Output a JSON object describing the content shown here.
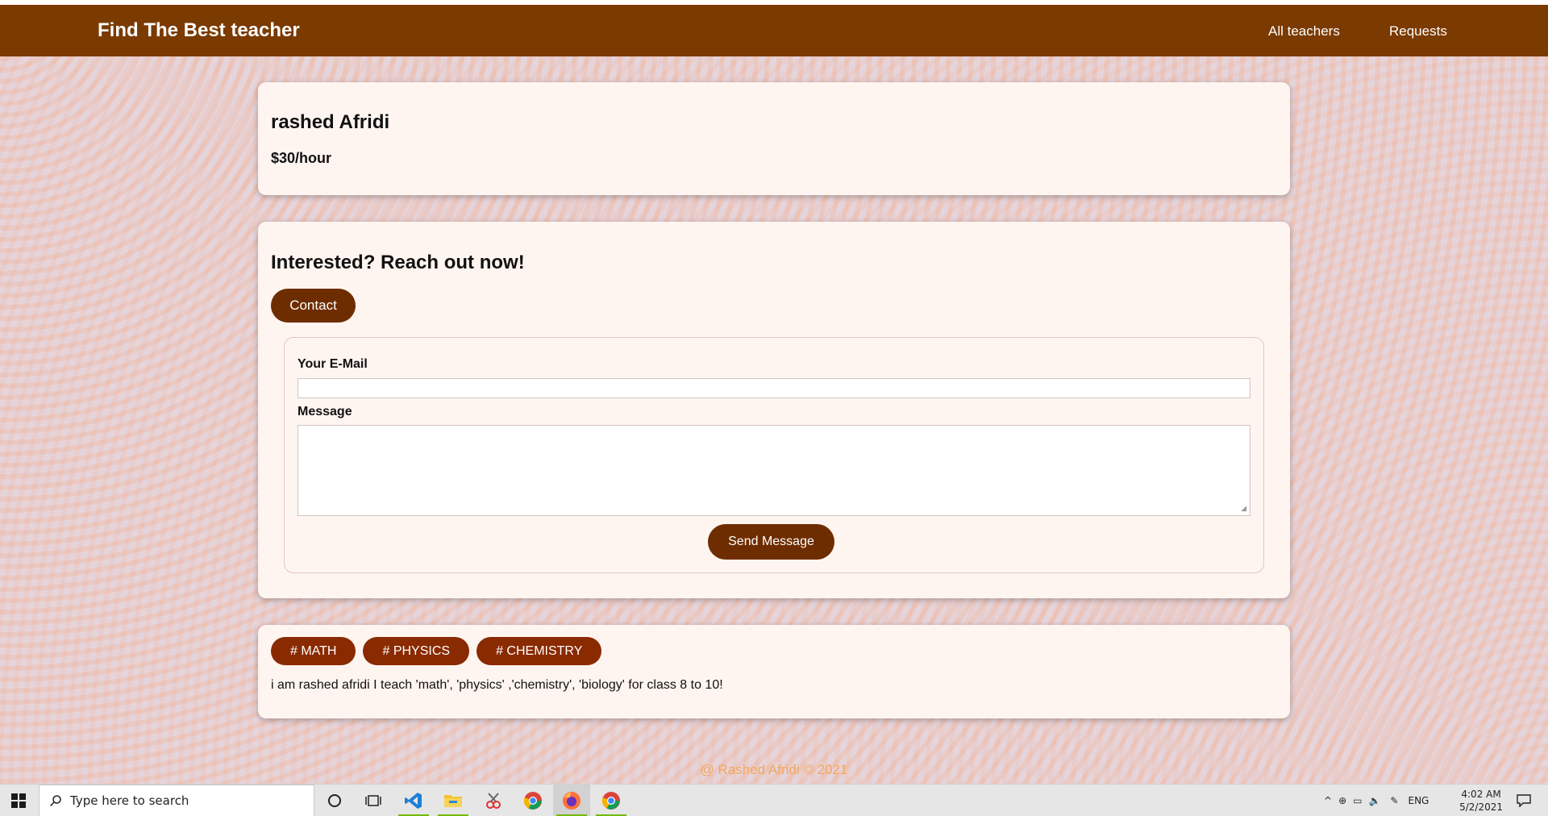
{
  "header": {
    "brand": "Find The Best teacher",
    "nav": [
      "All teachers",
      "Requests"
    ]
  },
  "teacher": {
    "name": "rashed Afridi",
    "rate": "$30/hour"
  },
  "contact_section": {
    "title": "Interested? Reach out now!",
    "contact_button": "Contact",
    "email_label": "Your E-Mail",
    "email_value": "",
    "message_label": "Message",
    "message_value": "",
    "send_button": "Send Message"
  },
  "details": {
    "tags": [
      "# MATH",
      "# PHYSICS",
      "# CHEMISTRY"
    ],
    "description": "i am rashed afridi I teach 'math', 'physics' ,'chemistry', 'biology' for class 8 to 10!"
  },
  "footer": {
    "text": "@ Rashed Afridi © 2021"
  },
  "taskbar": {
    "search_placeholder": "Type here to search",
    "language": "ENG",
    "time": "4:02 AM",
    "date": "5/2/2021"
  },
  "colors": {
    "navbar": "#7a3a00",
    "button": "#6e2d00",
    "tag": "#8a2a00",
    "footer_text": "#f2a85c",
    "card_bg": "#fff5f0"
  }
}
